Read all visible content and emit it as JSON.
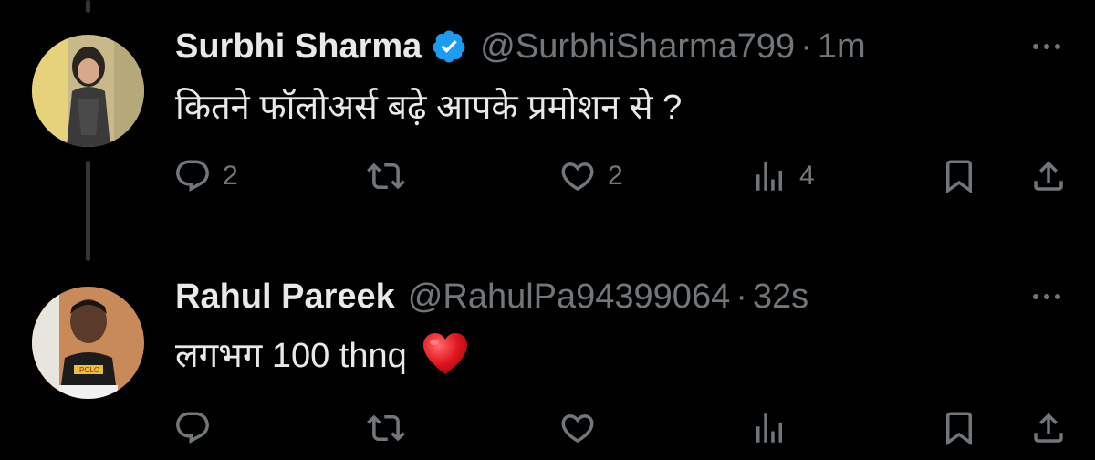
{
  "tweets": [
    {
      "author": {
        "name": "Surbhi Sharma",
        "handle": "@SurbhiSharma799",
        "verified": true,
        "avatar_icon": "avatar-woman-photo"
      },
      "separator": "·",
      "time": "1m",
      "text": "कितने फॉलोअर्स बढ़े आपके प्रमोशन से ?",
      "stats": {
        "replies": "2",
        "retweets": "",
        "likes": "2",
        "views": "4"
      }
    },
    {
      "author": {
        "name": "Rahul Pareek",
        "handle": "@RahulPa94399064",
        "verified": false,
        "avatar_icon": "avatar-man-photo"
      },
      "separator": "·",
      "time": "32s",
      "text": "लगभग 100 thnq",
      "emoji": "red-heart-emoji",
      "stats": {
        "replies": "",
        "retweets": "",
        "likes": "",
        "views": ""
      }
    }
  ],
  "icons": {
    "reply": "reply-icon",
    "retweet": "retweet-icon",
    "like": "heart-icon",
    "views": "views-icon",
    "bookmark": "bookmark-icon",
    "share": "share-icon",
    "more": "more-icon"
  },
  "colors": {
    "background": "#000000",
    "text": "#e7e9ea",
    "secondary": "#71767b",
    "verified": "#1d9bf0",
    "thread_line": "#333639"
  }
}
